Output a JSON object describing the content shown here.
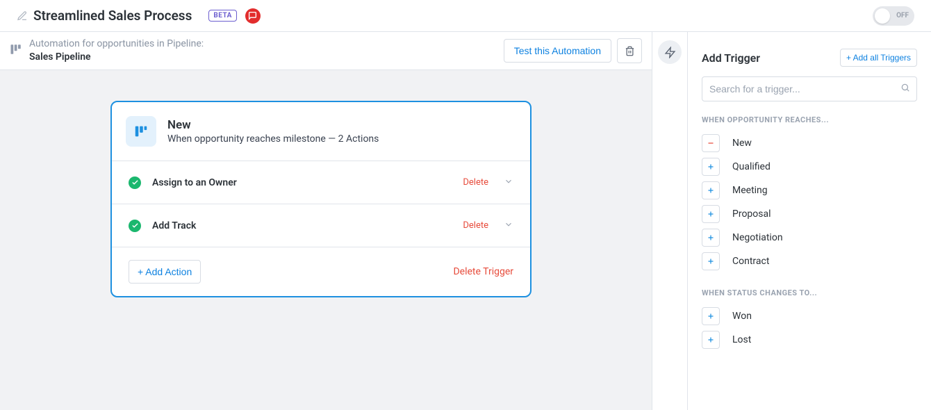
{
  "header": {
    "title": "Streamlined Sales Process",
    "beta": "BETA",
    "toggle_state": "OFF"
  },
  "subheader": {
    "label": "Automation for opportunities in Pipeline:",
    "pipeline_name": "Sales Pipeline",
    "test_label": "Test this Automation"
  },
  "trigger_card": {
    "title": "New",
    "subtitle": "When opportunity reaches milestone — 2 Actions",
    "actions": [
      {
        "name": "Assign to an Owner",
        "delete": "Delete"
      },
      {
        "name": "Add Track",
        "delete": "Delete"
      }
    ],
    "add_action": "+ Add Action",
    "delete_trigger": "Delete Trigger"
  },
  "right_panel": {
    "title": "Add Trigger",
    "add_all": "+ Add all Triggers",
    "search_placeholder": "Search for a trigger...",
    "section_milestone": "When opportunity reaches...",
    "milestone_items": [
      {
        "label": "New",
        "mode": "minus"
      },
      {
        "label": "Qualified",
        "mode": "plus"
      },
      {
        "label": "Meeting",
        "mode": "plus"
      },
      {
        "label": "Proposal",
        "mode": "plus"
      },
      {
        "label": "Negotiation",
        "mode": "plus"
      },
      {
        "label": "Contract",
        "mode": "plus"
      }
    ],
    "section_status": "When status changes to...",
    "status_items": [
      {
        "label": "Won",
        "mode": "plus"
      },
      {
        "label": "Lost",
        "mode": "plus"
      }
    ]
  }
}
